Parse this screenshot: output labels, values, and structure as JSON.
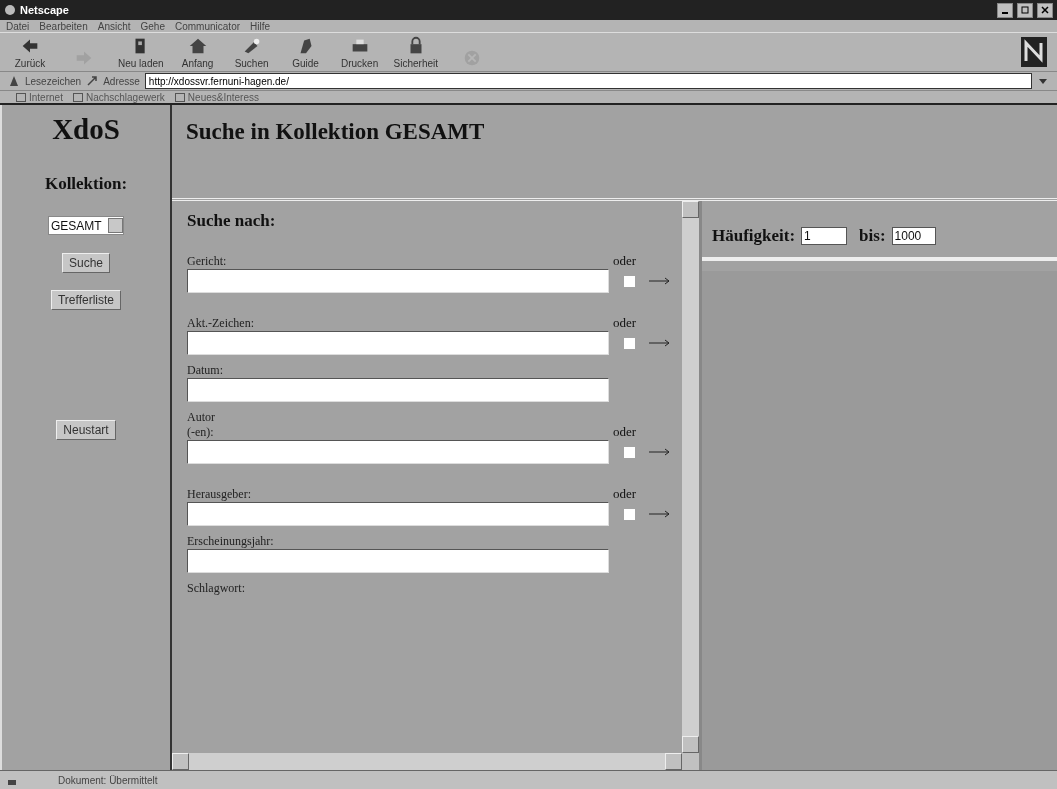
{
  "window": {
    "title": "Netscape"
  },
  "menu": [
    "Datei",
    "Bearbeiten",
    "Ansicht",
    "Gehe",
    "Communicator",
    "Hilfe"
  ],
  "toolbar": [
    {
      "label": "Zurück",
      "kind": "back",
      "disabled": false
    },
    {
      "kind": "forward",
      "disabled": true
    },
    {
      "label": "Neu laden",
      "kind": "reload",
      "disabled": false
    },
    {
      "label": "Anfang",
      "kind": "home",
      "disabled": false
    },
    {
      "label": "Suchen",
      "kind": "search",
      "disabled": false
    },
    {
      "label": "Guide",
      "kind": "guide",
      "disabled": false
    },
    {
      "label": "Drucken",
      "kind": "print",
      "disabled": false
    },
    {
      "label": "Sicherheit",
      "kind": "security",
      "disabled": false
    },
    {
      "kind": "stop",
      "disabled": true
    }
  ],
  "location": {
    "bookmarks": "Lesezeichen",
    "address_label": "Adresse",
    "url": "http://xdossvr.fernuni-hagen.de/"
  },
  "personal_bar": [
    "Internet",
    "Nachschlagewerk",
    "Neues&Interess"
  ],
  "sidebar": {
    "logo": "XdoS",
    "collection_label": "Kollektion:",
    "collection": "GESAMT",
    "buttons": [
      "Suche",
      "Trefferliste"
    ],
    "restart": "Neustart"
  },
  "header": {
    "title": "Suche in Kollektion GESAMT"
  },
  "search": {
    "title": "Suche nach:",
    "fields": [
      {
        "kind": "field",
        "label": "Gericht:",
        "oder": "oder",
        "checked": false
      },
      {
        "kind": "field",
        "label": "Akt.-Zeichen:",
        "oder": "oder",
        "checked": false
      },
      {
        "kind": "field",
        "label": "Datum:"
      },
      {
        "kind": "field",
        "label": "Autor\n(-en):",
        "oder": "oder",
        "checked": false
      },
      {
        "kind": "field",
        "label": "Herausgeber:",
        "oder": "oder",
        "checked": false
      },
      {
        "kind": "field",
        "label": "Erscheinungsjahr:"
      },
      {
        "kind": "label",
        "label": "Schlagwort:"
      }
    ]
  },
  "frequency": {
    "label": "Häufigkeit:",
    "from": "1",
    "to_label": "bis:",
    "to": "1000"
  },
  "status_bar": {
    "text": "Dokument: Übermittelt"
  }
}
